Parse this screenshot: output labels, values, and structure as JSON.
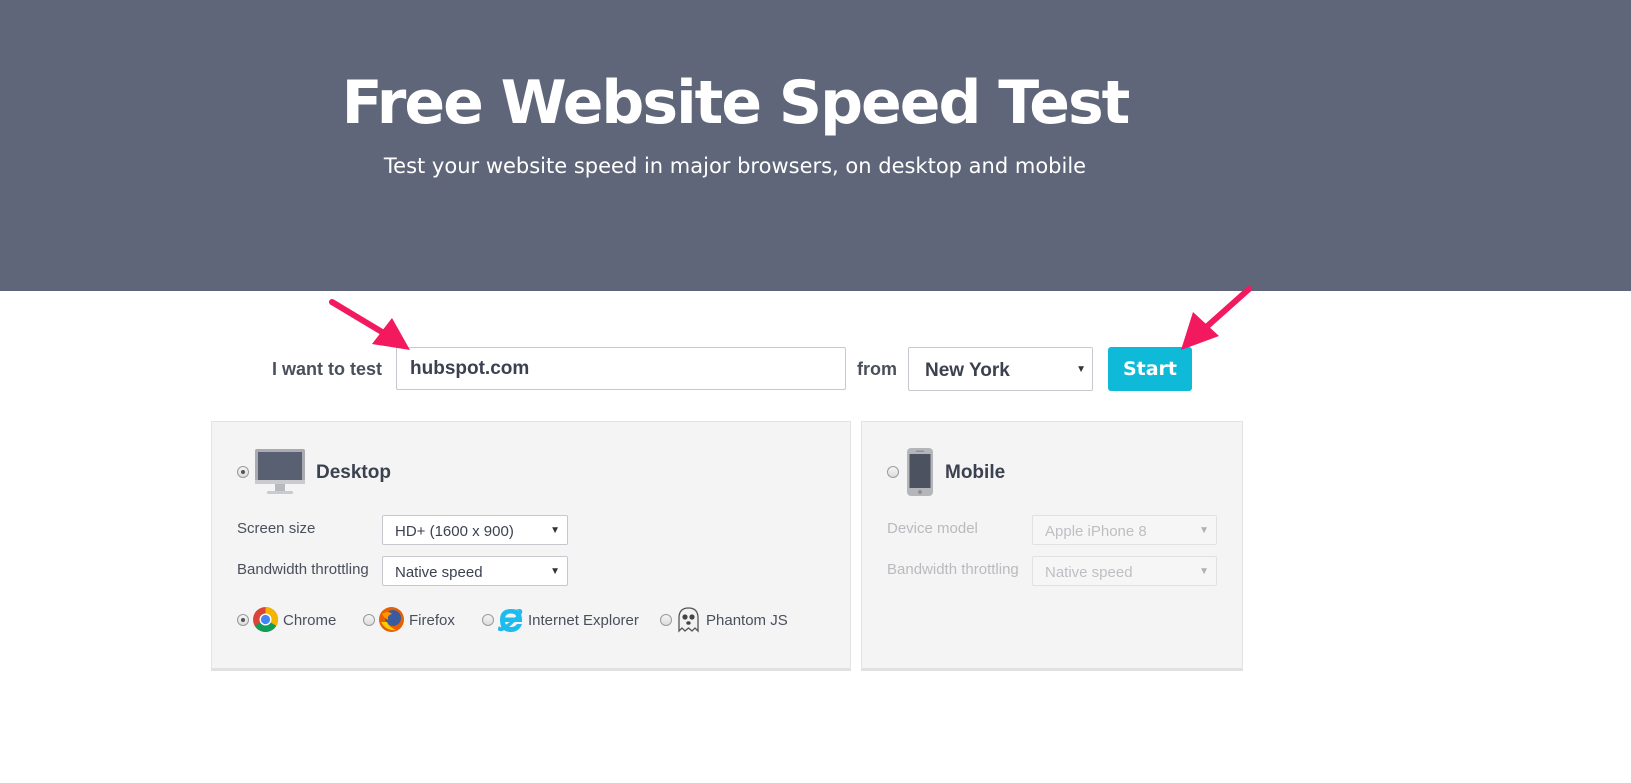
{
  "hero": {
    "title": "Free Website Speed Test",
    "subtitle": "Test your website speed in major browsers, on desktop and mobile",
    "background": "#606679"
  },
  "test_form": {
    "label": "I want to test",
    "url_value": "hubspot.com",
    "from_label": "from",
    "location_value": "New York",
    "start_label": "Start",
    "start_color": "#0fb9d8"
  },
  "desktop": {
    "title": "Desktop",
    "selected": true,
    "icon": "desktop-monitor-icon",
    "screen_size_label": "Screen size",
    "screen_size_value": "HD+ (1600 x 900)",
    "bandwidth_label": "Bandwidth throttling",
    "bandwidth_value": "Native speed",
    "browsers": [
      {
        "name": "Chrome",
        "icon": "chrome-icon",
        "selected": true
      },
      {
        "name": "Firefox",
        "icon": "firefox-icon",
        "selected": false
      },
      {
        "name": "Internet Explorer",
        "icon": "internet-explorer-icon",
        "selected": false
      },
      {
        "name": "Phantom JS",
        "icon": "phantomjs-ghost-icon",
        "selected": false
      }
    ]
  },
  "mobile": {
    "title": "Mobile",
    "selected": false,
    "icon": "smartphone-icon",
    "device_label": "Device model",
    "device_value": "Apple iPhone 8",
    "bandwidth_label": "Bandwidth throttling",
    "bandwidth_value": "Native speed"
  },
  "annotations": {
    "arrow_color": "#f2195e"
  }
}
